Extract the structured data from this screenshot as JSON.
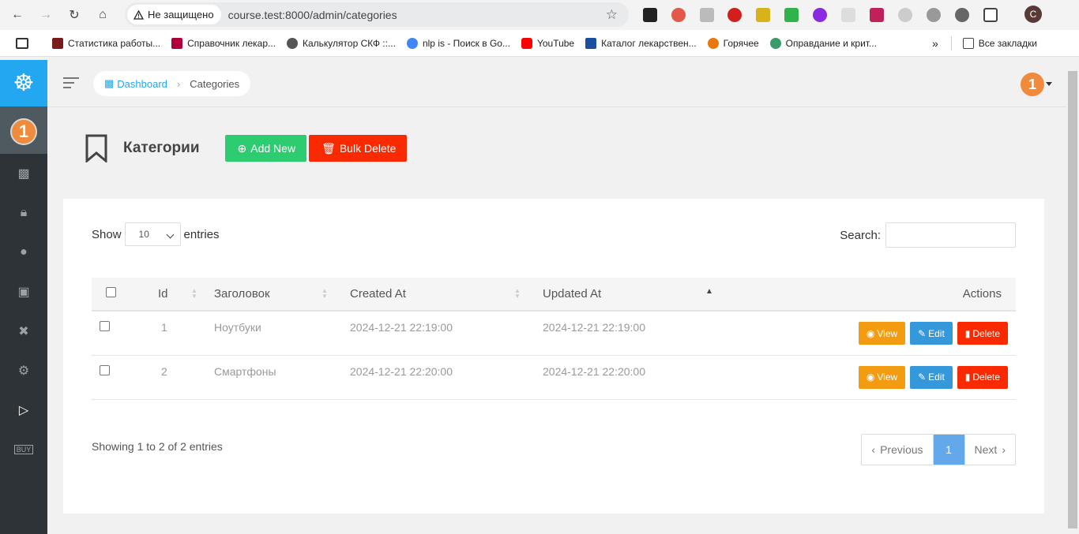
{
  "browser": {
    "security_label": "Не защищено",
    "url": "course.test:8000/admin/categories",
    "profile_initial": "C",
    "bookmarks": [
      {
        "label": "Статистика работы...",
        "color": "#7a1a1a"
      },
      {
        "label": "Справочник лекар...",
        "color": "#b0003a"
      },
      {
        "label": "Калькулятор СКФ ::...",
        "color": "#555555"
      },
      {
        "label": "nlp is - Поиск в Go...",
        "color": "#4285f4"
      },
      {
        "label": "YouTube",
        "color": "#ff0000"
      },
      {
        "label": "Каталог лекарствен...",
        "color": "#1a4fa0"
      },
      {
        "label": "Горячее",
        "color": "#e8790c"
      },
      {
        "label": "Оправдание и крит...",
        "color": "#3a9a6a"
      }
    ],
    "all_bookmarks_label": "Все закладки"
  },
  "topbar": {
    "breadcrumb_home": "Dashboard",
    "breadcrumb_current": "Categories",
    "avatar_text": "1"
  },
  "sidebar": {
    "avatar_text": "1"
  },
  "page": {
    "title": "Категории",
    "add_new_label": "Add New",
    "bulk_delete_label": "Bulk Delete"
  },
  "table": {
    "show_label": "Show",
    "entries_label": "entries",
    "page_size": "10",
    "search_label": "Search:",
    "columns": [
      "Id",
      "Заголовок",
      "Created At",
      "Updated At",
      "Actions"
    ],
    "rows": [
      {
        "id": "1",
        "title": "Ноутбуки",
        "created": "2024-12-21 22:19:00",
        "updated": "2024-12-21 22:19:00"
      },
      {
        "id": "2",
        "title": "Смартфоны",
        "created": "2024-12-21 22:20:00",
        "updated": "2024-12-21 22:20:00"
      }
    ],
    "actions": {
      "view": "View",
      "edit": "Edit",
      "delete": "Delete"
    },
    "info": "Showing 1 to 2 of 2 entries",
    "pager": {
      "previous": "Previous",
      "current": "1",
      "next": "Next"
    }
  }
}
